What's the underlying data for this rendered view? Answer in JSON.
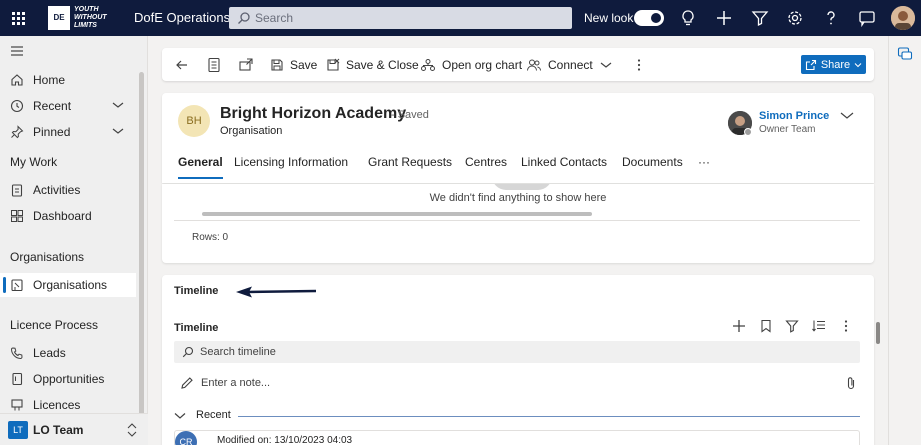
{
  "topbar": {
    "logo_text": "DE",
    "logo_tagline": "YOUTH WITHOUT LIMITS",
    "app_title": "DofE Operations",
    "search_placeholder": "Search",
    "new_look_label": "New look",
    "new_look_on": true,
    "icons": [
      "waffle-icon",
      "lightbulb-icon",
      "plus-icon",
      "filter-icon",
      "gear-icon",
      "help-icon",
      "chat-icon"
    ]
  },
  "sidebar": {
    "items_top": [
      {
        "label": "Home",
        "icon": "home-icon"
      },
      {
        "label": "Recent",
        "icon": "clock-icon",
        "expandable": true
      },
      {
        "label": "Pinned",
        "icon": "pin-icon",
        "expandable": true
      }
    ],
    "my_work_heading": "My Work",
    "my_work_items": [
      {
        "label": "Activities",
        "icon": "clipboard-icon"
      },
      {
        "label": "Dashboard",
        "icon": "dashboard-icon"
      }
    ],
    "organisations_heading": "Organisations",
    "organisations_items": [
      {
        "label": "Organisations",
        "icon": "building-icon",
        "active": true
      }
    ],
    "licence_heading": "Licence Process",
    "licence_items": [
      {
        "label": "Leads",
        "icon": "phone-icon"
      },
      {
        "label": "Opportunities",
        "icon": "document-icon"
      },
      {
        "label": "Licences",
        "icon": "certificate-icon"
      }
    ],
    "area": {
      "badge": "LT",
      "label": "LO Team"
    }
  },
  "commandbar": {
    "save": "Save",
    "save_close": "Save & Close",
    "org_chart": "Open org chart",
    "connect": "Connect",
    "share": "Share"
  },
  "record": {
    "initials": "BH",
    "title": "Bright Horizon Academy",
    "saved_status": "- Saved",
    "entity": "Organisation",
    "owner_name": "Simon Prince",
    "owner_role": "Owner Team",
    "tabs": [
      "General",
      "Licensing Information",
      "Grant Requests",
      "Centres",
      "Linked Contacts",
      "Documents"
    ],
    "active_tab": "General",
    "more_tabs": "···"
  },
  "grid": {
    "empty_message": "We didn't find anything to show here",
    "rows_label": "Rows: 0"
  },
  "timeline": {
    "section_label": "Timeline",
    "header": "Timeline",
    "search_placeholder": "Search timeline",
    "note_placeholder": "Enter a note...",
    "recent_label": "Recent",
    "entry_initials": "CR",
    "entry_modified": "Modified on: 13/10/2023 04:03"
  },
  "colors": {
    "topbar": "#0f1b3d",
    "accent": "#0f6cbd",
    "arrow": "#0f1b3d"
  }
}
